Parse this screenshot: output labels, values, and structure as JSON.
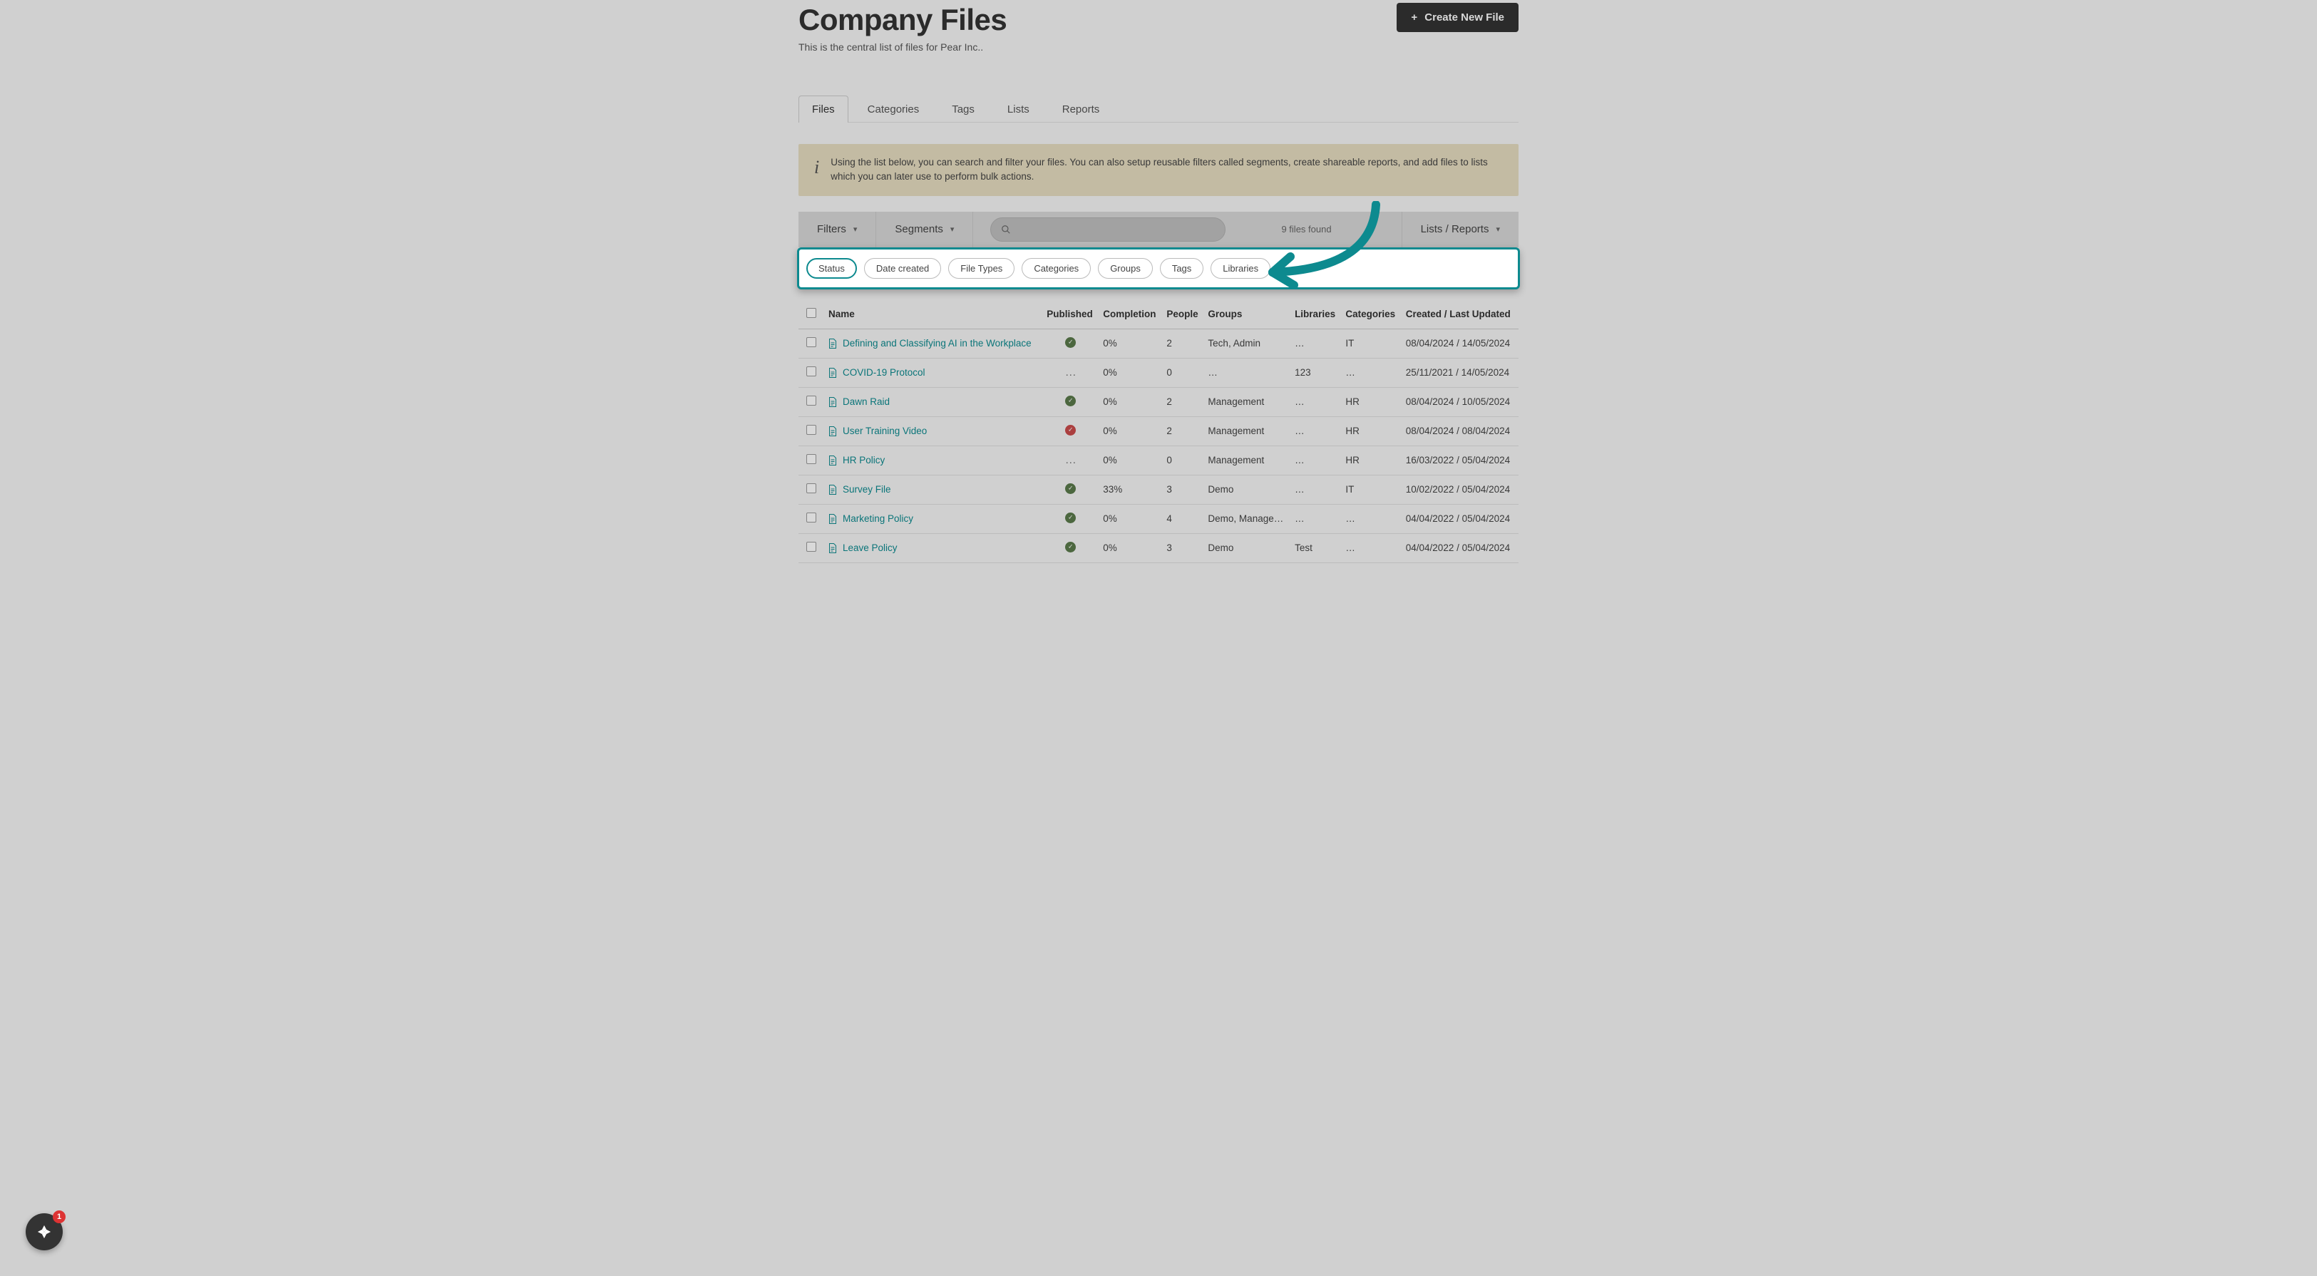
{
  "header": {
    "title": "Company Files",
    "subtitle": "This is the central list of files for Pear Inc..",
    "create_btn": "Create New File"
  },
  "tabs": [
    "Files",
    "Categories",
    "Tags",
    "Lists",
    "Reports"
  ],
  "active_tab": 0,
  "info_banner": "Using the list below, you can search and filter your files. You can also setup reusable filters called segments, create shareable reports, and add files to lists which you can later use to perform bulk actions.",
  "toolbar": {
    "filters": "Filters",
    "segments": "Segments",
    "lists_reports": "Lists / Reports",
    "files_found": "9 files found"
  },
  "filter_chips": [
    "Status",
    "Date created",
    "File Types",
    "Categories",
    "Groups",
    "Tags",
    "Libraries"
  ],
  "active_chip": 0,
  "columns": [
    "Name",
    "Published",
    "Completion",
    "People",
    "Groups",
    "Libraries",
    "Categories",
    "Created / Last Updated"
  ],
  "rows": [
    {
      "name": "Defining and Classifying AI in the Workplace",
      "published": "green",
      "completion": "0%",
      "people": "2",
      "groups": "Tech, Admin",
      "libraries": "…",
      "categories": "IT",
      "dates": "08/04/2024 / 14/05/2024"
    },
    {
      "name": "COVID-19 Protocol",
      "published": "dash",
      "completion": "0%",
      "people": "0",
      "groups": "…",
      "libraries": "123",
      "categories": "…",
      "dates": "25/11/2021 / 14/05/2024"
    },
    {
      "name": "Dawn Raid",
      "published": "green",
      "completion": "0%",
      "people": "2",
      "groups": "Management",
      "libraries": "…",
      "categories": "HR",
      "dates": "08/04/2024 / 10/05/2024"
    },
    {
      "name": "User Training Video",
      "published": "red",
      "completion": "0%",
      "people": "2",
      "groups": "Management",
      "libraries": "…",
      "categories": "HR",
      "dates": "08/04/2024 / 08/04/2024"
    },
    {
      "name": "HR Policy",
      "published": "dash",
      "completion": "0%",
      "people": "0",
      "groups": "Management",
      "libraries": "…",
      "categories": "HR",
      "dates": "16/03/2022 / 05/04/2024"
    },
    {
      "name": "Survey File",
      "published": "green",
      "completion": "33%",
      "people": "3",
      "groups": "Demo",
      "libraries": "…",
      "categories": "IT",
      "dates": "10/02/2022 / 05/04/2024"
    },
    {
      "name": "Marketing Policy",
      "published": "green",
      "completion": "0%",
      "people": "4",
      "groups": "Demo, Manage…",
      "libraries": "…",
      "categories": "…",
      "dates": "04/04/2022 / 05/04/2024"
    },
    {
      "name": "Leave Policy",
      "published": "green",
      "completion": "0%",
      "people": "3",
      "groups": "Demo",
      "libraries": "Test",
      "categories": "…",
      "dates": "04/04/2022 / 05/04/2024"
    }
  ],
  "float_badge_count": "1"
}
